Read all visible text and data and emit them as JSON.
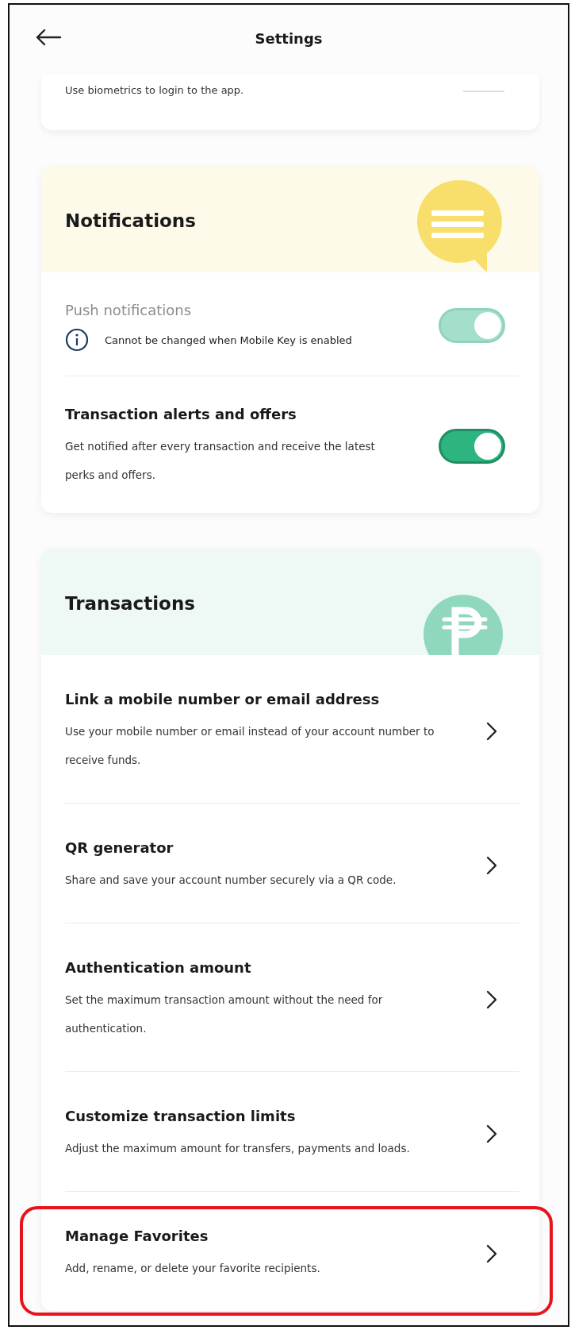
{
  "header": {
    "title": "Settings"
  },
  "top_card": {
    "description": "Use biometrics to login to the app."
  },
  "sections": [
    {
      "kind": "notifications",
      "title": "Notifications",
      "items": [
        {
          "kind": "toggle",
          "title": "Push notifications",
          "note": "Cannot be changed when Mobile Key is enabled",
          "on": true,
          "disabled": true
        },
        {
          "kind": "toggle",
          "title": "Transaction alerts and offers",
          "description": "Get notified after every transaction and receive the latest perks and offers.",
          "on": true,
          "disabled": false
        }
      ]
    },
    {
      "kind": "transactions",
      "title": "Transactions",
      "items": [
        {
          "kind": "link",
          "title": "Link a mobile number or email address",
          "description": "Use your mobile number or email instead of your account number to receive funds.",
          "highlighted": false
        },
        {
          "kind": "link",
          "title": "QR generator",
          "description": "Share and save your account number securely via a QR code.",
          "highlighted": false
        },
        {
          "kind": "link",
          "title": "Authentication amount",
          "description": "Set the maximum transaction amount without the need for authentication.",
          "highlighted": false
        },
        {
          "kind": "link",
          "title": "Customize transaction limits",
          "description": "Adjust the maximum amount for transfers, payments and loads.",
          "highlighted": false
        },
        {
          "kind": "link",
          "title": "Manage Favorites",
          "description": "Add, rename, or delete your favorite recipients.",
          "highlighted": true
        }
      ]
    }
  ]
}
